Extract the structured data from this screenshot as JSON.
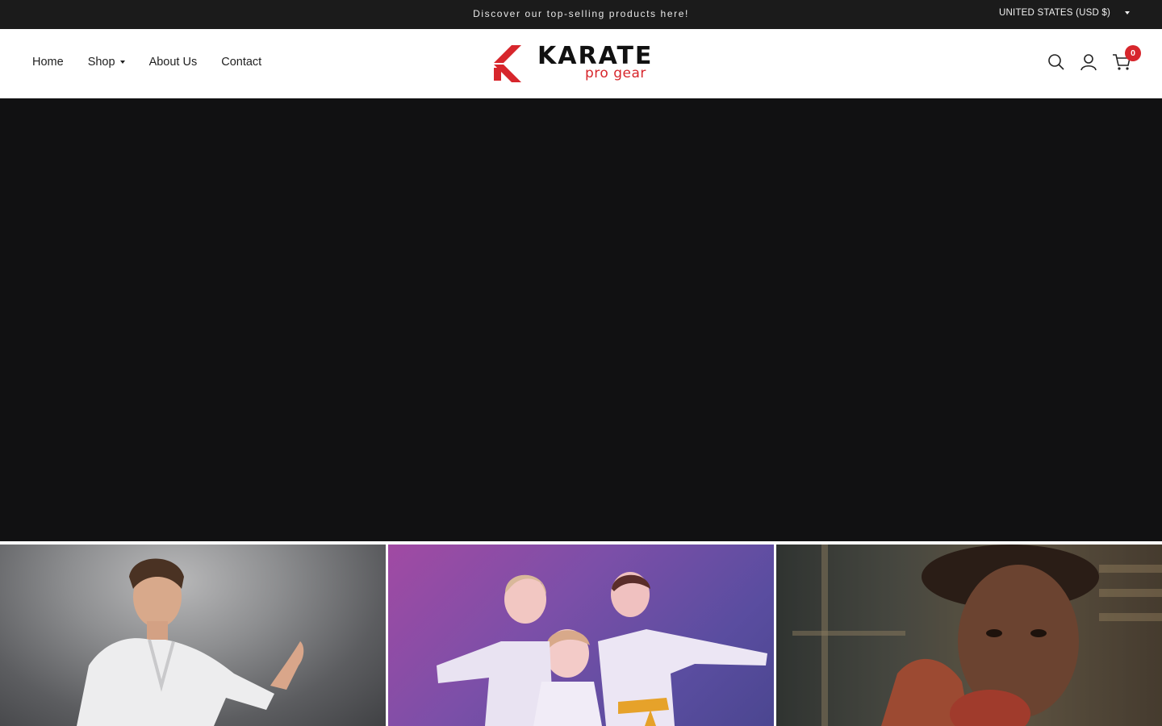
{
  "announcement": {
    "message": "Discover our top-selling products here!",
    "country_selector": "UNITED STATES (USD $)"
  },
  "nav": {
    "items": [
      {
        "label": "Home"
      },
      {
        "label": "Shop"
      },
      {
        "label": "About Us"
      },
      {
        "label": "Contact"
      }
    ]
  },
  "logo": {
    "brand": "KARATE",
    "tagline": "pro gear"
  },
  "header_icons": [
    "search-icon",
    "account-icon",
    "cart-icon"
  ],
  "cart": {
    "count": "0"
  },
  "colors": {
    "accent": "#d7262c",
    "announcement_bg": "#1b1b1b",
    "hero_bg": "#111112"
  },
  "collections": [
    {
      "image": "boy in white karate gi, grey backdrop"
    },
    {
      "image": "three kids in karate gis, purple lighting"
    },
    {
      "image": "girl with boxing gloves, warm light"
    }
  ]
}
